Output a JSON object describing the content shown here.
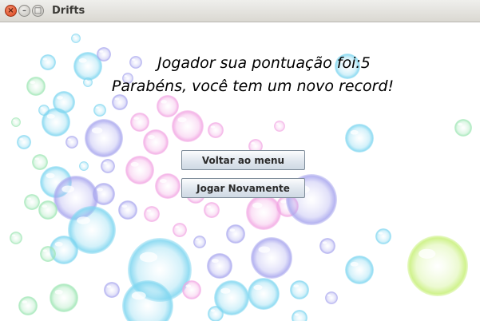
{
  "window": {
    "title": "Drifts",
    "controls": [
      "close-icon",
      "minimize-icon",
      "maximize-icon"
    ]
  },
  "message": {
    "score_line": "Jogador sua pontuação foi:5",
    "record_line": "Parabéns, você tem um novo record!"
  },
  "buttons": {
    "back_to_menu": "Voltar ao menu",
    "play_again": "Jogar Novamente"
  },
  "colors": {
    "bubble_palette": [
      "#7fd6f0",
      "#a9a7ee",
      "#f2a7e3",
      "#9ee6b4",
      "#c8f07a"
    ],
    "button_border": "#7d8b99",
    "close_button": "#d9441c"
  }
}
